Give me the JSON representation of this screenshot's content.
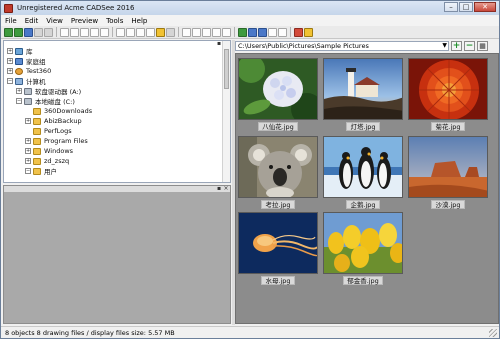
{
  "window": {
    "title": "Unregistered Acme CADSee 2016"
  },
  "menu": [
    "File",
    "Edit",
    "View",
    "Preview",
    "Tools",
    "Help"
  ],
  "toolbar": {
    "icons": [
      "open-icon",
      "refresh-icon",
      "back-icon",
      "save-icon",
      "print-icon",
      "zoom-in-icon",
      "zoom-out-icon",
      "zoom-window-icon",
      "zoom-fit-icon",
      "zoom-extents-icon",
      "pan-icon",
      "select-icon",
      "rotate-icon",
      "mirror-icon",
      "copy-icon",
      "paste-icon",
      "delete-icon",
      "layers-icon",
      "measure-icon",
      "convert-icon",
      "text-icon",
      "grid-icon",
      "properties-icon",
      "register-icon",
      "help-icon"
    ]
  },
  "tree": [
    {
      "label": "库",
      "toggle": "+",
      "icon": "lib",
      "depth": 0
    },
    {
      "label": "家庭组",
      "toggle": "+",
      "icon": "home",
      "depth": 0
    },
    {
      "label": "Test360",
      "toggle": "+",
      "icon": "user",
      "depth": 0
    },
    {
      "label": "计算机",
      "toggle": "−",
      "icon": "pc",
      "depth": 0
    },
    {
      "label": "软盘驱动器 (A:)",
      "toggle": "+",
      "icon": "drive",
      "depth": 1
    },
    {
      "label": "本地磁盘 (C:)",
      "toggle": "−",
      "icon": "drive",
      "depth": 1
    },
    {
      "label": "360Downloads",
      "toggle": "",
      "icon": "folder",
      "depth": 2
    },
    {
      "label": "AbizBackup",
      "toggle": "+",
      "icon": "folder",
      "depth": 2
    },
    {
      "label": "PerfLogs",
      "toggle": "",
      "icon": "folder",
      "depth": 2
    },
    {
      "label": "Program Files",
      "toggle": "+",
      "icon": "folder",
      "depth": 2
    },
    {
      "label": "Windows",
      "toggle": "+",
      "icon": "folder",
      "depth": 2
    },
    {
      "label": "zd_zszq",
      "toggle": "+",
      "icon": "folder",
      "depth": 2
    },
    {
      "label": "用户",
      "toggle": "−",
      "icon": "folder",
      "depth": 2
    }
  ],
  "address": {
    "path": "C:\\Users\\Public\\Pictures\\Sample Pictures"
  },
  "thumbnails": [
    {
      "caption": "八仙花.jpg",
      "image": "hydrangea-photo"
    },
    {
      "caption": "灯塔.jpg",
      "image": "lighthouse-photo"
    },
    {
      "caption": "菊花.jpg",
      "image": "chrysanthemum-photo"
    },
    {
      "caption": "考拉.jpg",
      "image": "koala-photo"
    },
    {
      "caption": "企鹅.jpg",
      "image": "penguins-photo"
    },
    {
      "caption": "沙漠.jpg",
      "image": "desert-photo"
    },
    {
      "caption": "水母.jpg",
      "image": "jellyfish-photo"
    },
    {
      "caption": "郁金香.jpg",
      "image": "tulips-photo"
    }
  ],
  "status": {
    "text": "8 objects 8 drawing files / display files size: 5.57 MB"
  }
}
